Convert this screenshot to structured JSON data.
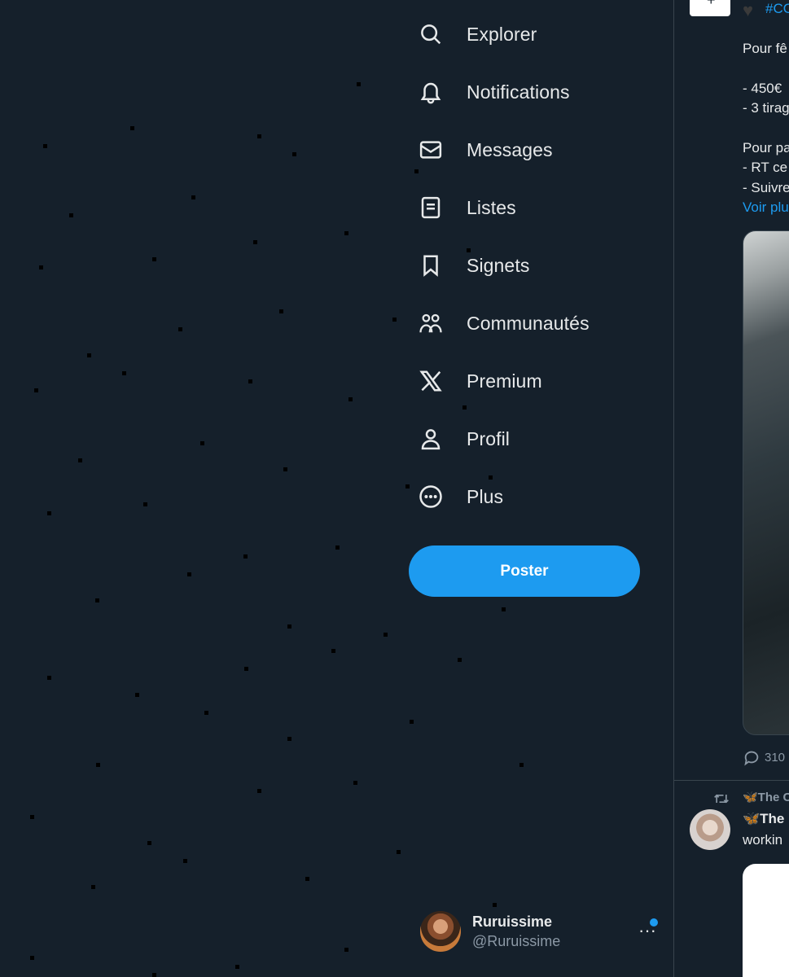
{
  "nav": {
    "items": [
      {
        "label": "Explorer",
        "icon": "search-icon"
      },
      {
        "label": "Notifications",
        "icon": "bell-icon"
      },
      {
        "label": "Messages",
        "icon": "envelope-icon"
      },
      {
        "label": "Listes",
        "icon": "list-icon"
      },
      {
        "label": "Signets",
        "icon": "bookmark-icon"
      },
      {
        "label": "Communautés",
        "icon": "communities-icon"
      },
      {
        "label": "Premium",
        "icon": "x-logo-icon"
      },
      {
        "label": "Profil",
        "icon": "person-icon"
      },
      {
        "label": "Plus",
        "icon": "more-circle-icon"
      }
    ],
    "post_label": "Poster"
  },
  "account": {
    "name": "Ruruissime",
    "handle": "@Ruruissime",
    "more": "···"
  },
  "feed": {
    "tweet1": {
      "hashtag": "#CO",
      "lines": [
        "Pour fê",
        "- 450€",
        "- 3 tirag",
        "Pour pa",
        "- RT ce",
        "- Suivre"
      ],
      "see_more": "Voir plu",
      "reply_count": "310"
    },
    "tweet2": {
      "retweeted_by": "🦋The C",
      "name": "🦋The",
      "text": "workin"
    }
  },
  "colors": {
    "background": "#15202b",
    "accent": "#1d9bf0",
    "text": "#e7e9ea",
    "muted": "#8b98a5"
  }
}
